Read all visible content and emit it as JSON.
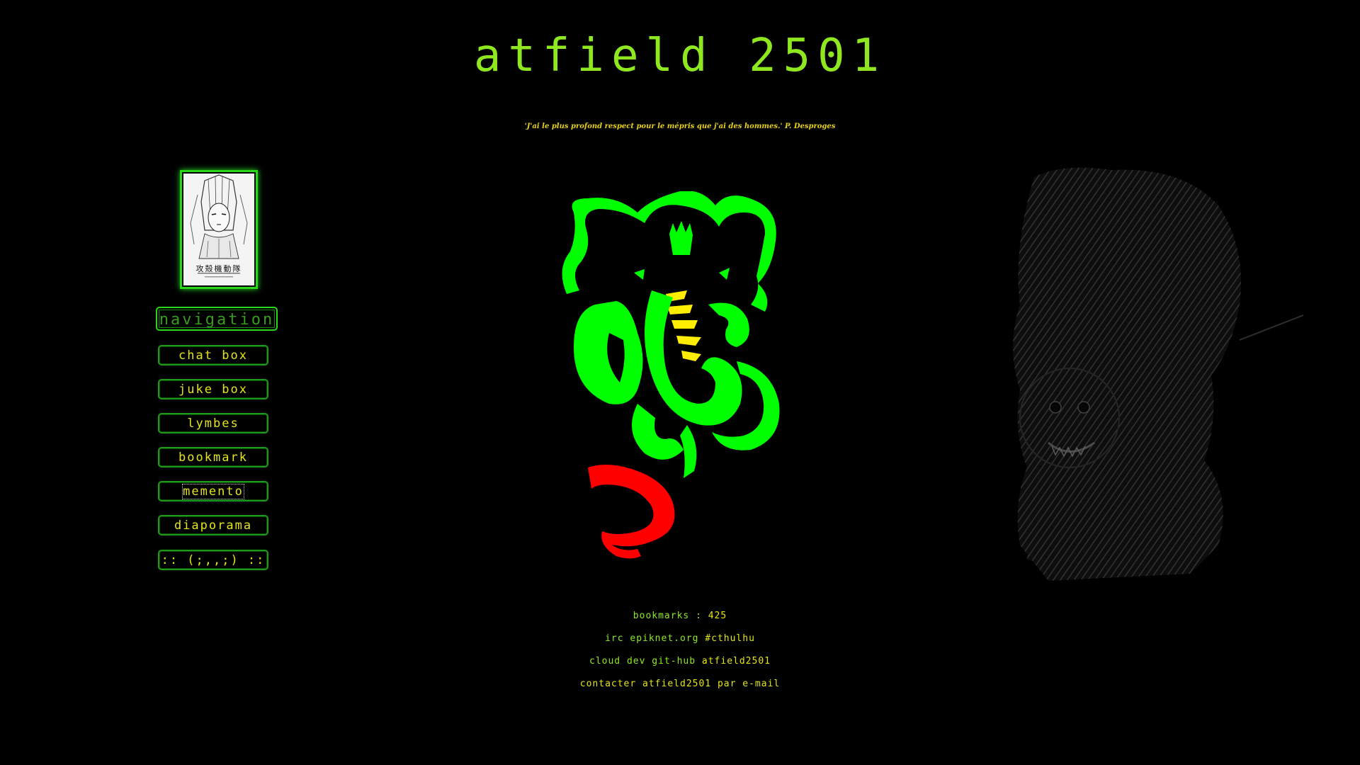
{
  "site": {
    "title": "atfield 2501",
    "quote": "'J'ai le plus profond respect pour le mépris que j'ai des hommes.' P. Desproges"
  },
  "poster": {
    "caption": "攻殻機動隊"
  },
  "navigation": {
    "header": "navigation",
    "items": [
      {
        "label": "chat box"
      },
      {
        "label": "juke box"
      },
      {
        "label": "lymbes"
      },
      {
        "label": "bookmark"
      },
      {
        "label": "memento"
      },
      {
        "label": "diaporama"
      },
      {
        "label": ":: (;,,;) ::"
      }
    ],
    "focused_item": "memento"
  },
  "footer": {
    "bookmarks_label": "bookmarks :",
    "bookmarks_count": "425",
    "irc_prefix": "irc epiknet.org",
    "irc_channel": "#cthulhu",
    "cloud_prefix": "cloud dev git-hub",
    "cloud_name": "atfield2501",
    "contact_prefix": "contacter atfield2501 par",
    "contact_link": "e-mail"
  },
  "colors": {
    "background": "#000000",
    "title_green": "#8fe81f",
    "button_text_yellow": "#e4e41a",
    "border_green": "#2ad61a",
    "ganesha_green": "#00ff00",
    "ganesha_red": "#ff0000",
    "ganesha_yellow": "#ffee00"
  },
  "icons": {
    "poster": "ghost-in-the-shell-poster",
    "ganesha": "ganesha-figure",
    "tiger": "tiger-drawing"
  }
}
